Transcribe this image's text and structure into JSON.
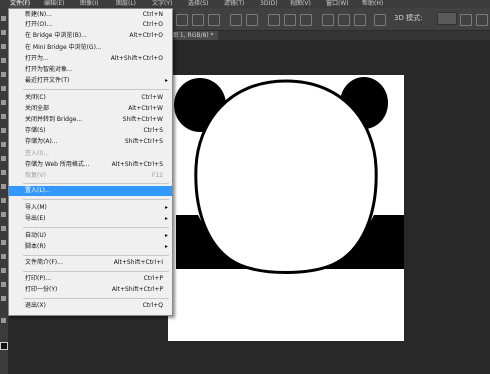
{
  "menubar": {
    "items": [
      "文件(F)",
      "编辑(E)",
      "图像(I)",
      "图层(L)",
      "文字(Y)",
      "选择(S)",
      "滤镜(T)",
      "3D(D)",
      "视图(V)",
      "窗口(W)",
      "帮助(H)"
    ]
  },
  "options_bar": {
    "mode_label": "3D 模式:"
  },
  "document": {
    "tab_label": "图 1, RGB/8) *"
  },
  "file_menu": {
    "items": [
      {
        "label": "新建(N)...",
        "shortcut": "Ctrl+N"
      },
      {
        "label": "打开(O)...",
        "shortcut": "Ctrl+O"
      },
      {
        "label": "在 Bridge 中浏览(B)...",
        "shortcut": "Alt+Ctrl+O"
      },
      {
        "label": "在 Mini Bridge 中浏览(G)...",
        "shortcut": ""
      },
      {
        "label": "打开为...",
        "shortcut": "Alt+Shift+Ctrl+O"
      },
      {
        "label": "打开为智能对象...",
        "shortcut": ""
      },
      {
        "label": "最近打开文件(T)",
        "shortcut": "",
        "submenu": true
      },
      {
        "label": "关闭(C)",
        "shortcut": "Ctrl+W"
      },
      {
        "label": "关闭全部",
        "shortcut": "Alt+Ctrl+W"
      },
      {
        "label": "关闭并转到 Bridge...",
        "shortcut": "Shift+Ctrl+W"
      },
      {
        "label": "存储(S)",
        "shortcut": "Ctrl+S"
      },
      {
        "label": "存储为(A)...",
        "shortcut": "Shift+Ctrl+S"
      },
      {
        "label": "签入(I)...",
        "shortcut": "",
        "disabled": true
      },
      {
        "label": "存储为 Web 所用格式...",
        "shortcut": "Alt+Shift+Ctrl+S"
      },
      {
        "label": "恢复(V)",
        "shortcut": "F12",
        "disabled": true
      },
      {
        "label": "置入(L)...",
        "shortcut": "",
        "highlighted": true
      },
      {
        "label": "导入(M)",
        "shortcut": "",
        "submenu": true
      },
      {
        "label": "导出(E)",
        "shortcut": "",
        "submenu": true
      },
      {
        "label": "自动(U)",
        "shortcut": "",
        "submenu": true
      },
      {
        "label": "脚本(R)",
        "shortcut": "",
        "submenu": true
      },
      {
        "label": "文件简介(F)...",
        "shortcut": "Alt+Shift+Ctrl+I"
      },
      {
        "label": "打印(P)...",
        "shortcut": "Ctrl+P"
      },
      {
        "label": "打印一份(Y)",
        "shortcut": "Alt+Shift+Ctrl+P"
      },
      {
        "label": "退出(X)",
        "shortcut": "Ctrl+Q"
      }
    ],
    "submenu_glyph": "▸"
  }
}
